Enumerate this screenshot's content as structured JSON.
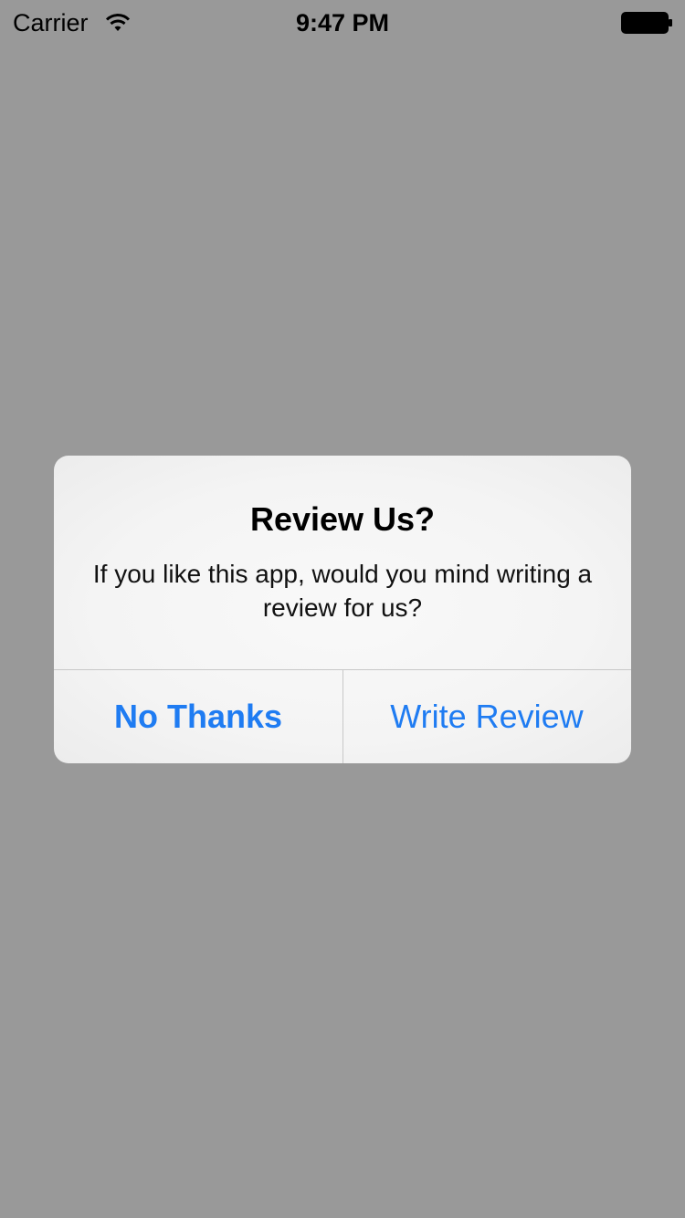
{
  "status_bar": {
    "carrier": "Carrier",
    "time": "9:47 PM",
    "wifi_icon": "wifi-icon",
    "battery_icon": "battery-icon"
  },
  "alert": {
    "title": "Review Us?",
    "message": "If you like this app, would you mind writing a review for us?",
    "buttons": [
      {
        "label": "No Thanks",
        "style": "bold"
      },
      {
        "label": "Write Review",
        "style": "regular"
      }
    ]
  },
  "colors": {
    "background_dim": "#999999",
    "alert_background": "#f6f6f6",
    "button_tint": "#1f7cf2",
    "separator": "#c8c8c8"
  }
}
